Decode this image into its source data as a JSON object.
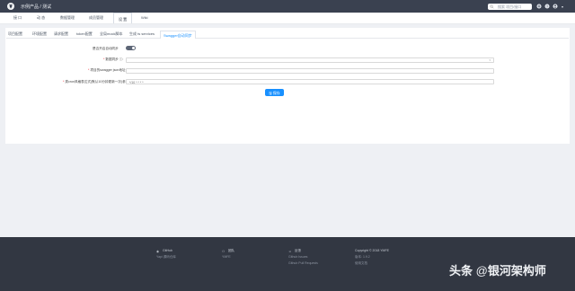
{
  "header": {
    "project_title": "示例产品 / 测试",
    "search_placeholder": "搜索 项目/接口",
    "icons": [
      "search-icon",
      "add-icon",
      "help-icon",
      "user-icon"
    ]
  },
  "main_tabs": [
    {
      "label": "接 口"
    },
    {
      "label": "动 态"
    },
    {
      "label": "数据管理"
    },
    {
      "label": "成员管理"
    },
    {
      "label": "设 置"
    },
    {
      "label": "Wiki"
    }
  ],
  "sub_tabs": [
    {
      "label": "项目配置"
    },
    {
      "label": "环境配置"
    },
    {
      "label": "请求配置"
    },
    {
      "label": "token配置"
    },
    {
      "label": "全局mock脚本"
    },
    {
      "label": "生成 ts services"
    },
    {
      "label": "Swagger自动同步"
    }
  ],
  "form": {
    "auto_sync_label": "是否开启自动同步",
    "data_sync_label": "数据同步",
    "swagger_url_label": "项目的swagger json地址",
    "cron_label": "类cron风格表达式(默认10分钟更新一次)参考",
    "cron_value": "*/10 * * * *",
    "save_label": "保存"
  },
  "footer": {
    "col1_title": "GitHub",
    "col1_sub": "Yapi 源码仓库",
    "col2_title": "团队",
    "col2_sub": "YMFE",
    "col3_title": "反馈",
    "col3_sub1": "Github Issues",
    "col3_sub2": "Github Pull Requests",
    "col4_title": "Copyright © 2018 YMFE",
    "col4_sub1": "版本: 1.9.2",
    "col4_sub2": "使用文档"
  },
  "watermark": {
    "prefix": "头条",
    "at": "@",
    "name": "银河架构师"
  },
  "colors": {
    "topbar": "#3a4150",
    "accent": "#1890ff",
    "footer": "#323742",
    "page_bg": "#eef0f4"
  }
}
